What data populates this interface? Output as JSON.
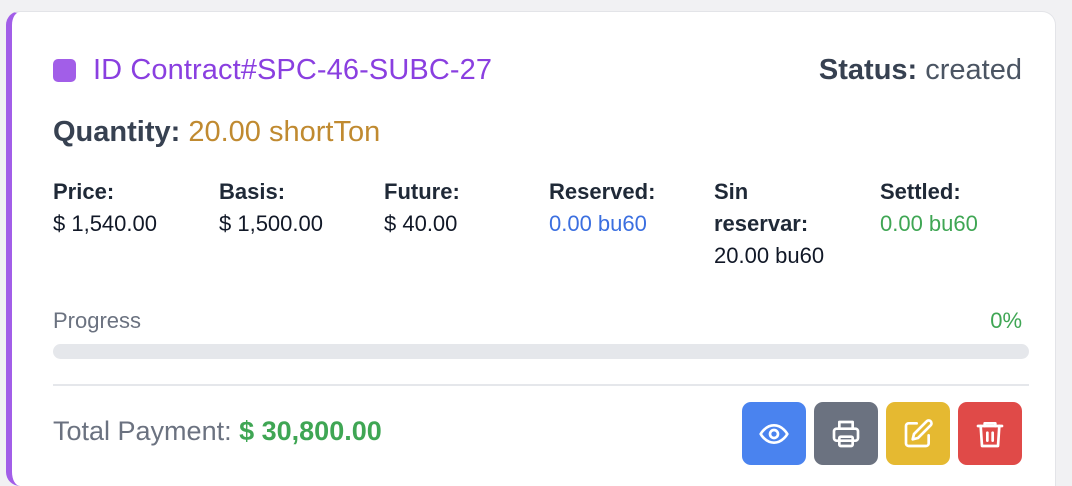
{
  "contract": {
    "id_label": "ID Contract#SPC-46-SUBC-27",
    "accent_color": "#a25ee8"
  },
  "status": {
    "label": "Status:",
    "value": "created"
  },
  "quantity": {
    "label": "Quantity:",
    "value": "20.00 shortTon"
  },
  "fields": {
    "price": {
      "label": "Price:",
      "value": "$ 1,540.00"
    },
    "basis": {
      "label": "Basis:",
      "value": "$ 1,500.00"
    },
    "future": {
      "label": "Future:",
      "value": "$ 40.00"
    },
    "reserved": {
      "label": "Reserved:",
      "value": "0.00 bu60"
    },
    "unreserved": {
      "label_line1": "Sin",
      "label_line2": "reservar:",
      "value": "20.00 bu60"
    },
    "settled": {
      "label": "Settled:",
      "value": "0.00 bu60"
    }
  },
  "progress": {
    "label": "Progress",
    "percent_text": "0%",
    "fraction": 0
  },
  "total": {
    "label": "Total Payment:",
    "value": "$ 30,800.00"
  },
  "actions": {
    "view_icon": "eye-icon",
    "print_icon": "printer-icon",
    "edit_icon": "edit-icon",
    "delete_icon": "trash-icon"
  }
}
